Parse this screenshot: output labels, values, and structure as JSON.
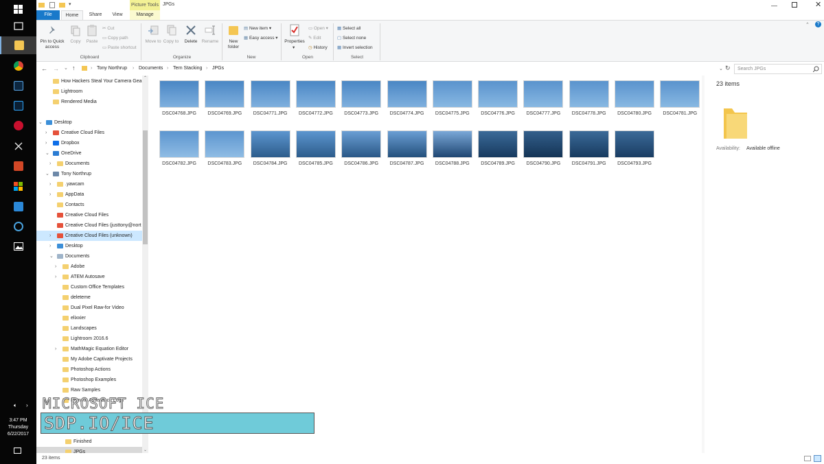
{
  "window": {
    "title": "JPGs",
    "contextual_tab": "Picture Tools"
  },
  "tabs": [
    "File",
    "Home",
    "Share",
    "View",
    "Manage"
  ],
  "ribbon": {
    "clipboard": {
      "pin": "Pin to Quick access",
      "copy": "Copy",
      "paste": "Paste",
      "cut": "Cut",
      "copy_path": "Copy path",
      "paste_shortcut": "Paste shortcut",
      "group": "Clipboard"
    },
    "organize": {
      "move_to": "Move to",
      "copy_to": "Copy to",
      "delete": "Delete",
      "rename": "Rename",
      "group": "Organize"
    },
    "new": {
      "new_folder": "New folder",
      "new_item": "New item",
      "easy_access": "Easy access",
      "group": "New"
    },
    "open": {
      "properties": "Properties",
      "open": "Open",
      "edit": "Edit",
      "history": "History",
      "group": "Open"
    },
    "select": {
      "select_all": "Select all",
      "select_none": "Select none",
      "invert": "Invert selection",
      "group": "Select"
    }
  },
  "address": {
    "crumbs": [
      "Tony Northrup",
      "Documents",
      "Tern Stacking",
      "JPGs"
    ],
    "search_placeholder": "Search JPGs"
  },
  "nav": [
    {
      "label": "How Hackers Steal Your Camera Gear",
      "level": 1,
      "icon": "folder",
      "chev": ""
    },
    {
      "label": "Lightroom",
      "level": 1,
      "icon": "folder",
      "chev": ""
    },
    {
      "label": "Rendered Media",
      "level": 1,
      "icon": "folder",
      "chev": ""
    },
    {
      "label": "",
      "level": 0,
      "icon": "",
      "chev": ""
    },
    {
      "label": "Desktop",
      "level": 0,
      "icon": "desktop",
      "chev": "v"
    },
    {
      "label": "Creative Cloud Files",
      "level": 1,
      "icon": "cc",
      "chev": ">"
    },
    {
      "label": "Dropbox",
      "level": 1,
      "icon": "dropbox",
      "chev": ">"
    },
    {
      "label": "OneDrive",
      "level": 1,
      "icon": "onedrive",
      "chev": "v"
    },
    {
      "label": "Documents",
      "level": 2,
      "icon": "folder",
      "chev": ">"
    },
    {
      "label": "Tony Northrup",
      "level": 1,
      "icon": "user",
      "chev": "v"
    },
    {
      "label": ".yawcam",
      "level": 2,
      "icon": "folder",
      "chev": ">"
    },
    {
      "label": "AppData",
      "level": 2,
      "icon": "folder",
      "chev": ">"
    },
    {
      "label": "Contacts",
      "level": 2,
      "icon": "folder",
      "chev": ""
    },
    {
      "label": "Creative Cloud Files",
      "level": 2,
      "icon": "cc",
      "chev": ""
    },
    {
      "label": "Creative Cloud Files (justtony@nort",
      "level": 2,
      "icon": "cc",
      "chev": ""
    },
    {
      "label": "Creative Cloud Files (unknown)",
      "level": 2,
      "icon": "cc",
      "chev": ">"
    },
    {
      "label": "Desktop",
      "level": 2,
      "icon": "desktop",
      "chev": ">"
    },
    {
      "label": "Documents",
      "level": 2,
      "icon": "docs",
      "chev": "v"
    },
    {
      "label": "Adobe",
      "level": 3,
      "icon": "folder",
      "chev": ">"
    },
    {
      "label": "ATEM Autosave",
      "level": 3,
      "icon": "folder",
      "chev": ">"
    },
    {
      "label": "Custom Office Templates",
      "level": 3,
      "icon": "folder",
      "chev": ""
    },
    {
      "label": "deleteme",
      "level": 3,
      "icon": "folder",
      "chev": ""
    },
    {
      "label": "Dual Pixel Raw-for Video",
      "level": 3,
      "icon": "folder",
      "chev": ""
    },
    {
      "label": "elixxier",
      "level": 3,
      "icon": "folder",
      "chev": ""
    },
    {
      "label": "Landscapes",
      "level": 3,
      "icon": "folder",
      "chev": ""
    },
    {
      "label": "Lightroom 2016.6",
      "level": 3,
      "icon": "folder",
      "chev": ""
    },
    {
      "label": "MathMagic Equation Editor",
      "level": 3,
      "icon": "folder",
      "chev": ">"
    },
    {
      "label": "My Adobe Captivate Projects",
      "level": 3,
      "icon": "folder",
      "chev": ""
    },
    {
      "label": "Photoshop Actions",
      "level": 3,
      "icon": "folder",
      "chev": ""
    },
    {
      "label": "Photoshop Examples",
      "level": 3,
      "icon": "folder",
      "chev": ""
    },
    {
      "label": "Raw Samples",
      "level": 3,
      "icon": "folder",
      "chev": ""
    },
    {
      "label": "Remote Assistance Logs",
      "level": 3,
      "icon": "folder",
      "chev": ""
    },
    {
      "label": "",
      "level": 3,
      "icon": "",
      "chev": ""
    },
    {
      "label": "",
      "level": 3,
      "icon": "",
      "chev": ""
    },
    {
      "label": "",
      "level": 3,
      "icon": "",
      "chev": ""
    },
    {
      "label": "Finished",
      "level": 4,
      "icon": "folder",
      "chev": ""
    },
    {
      "label": "JPGs",
      "level": 4,
      "icon": "folder",
      "chev": ""
    }
  ],
  "files": [
    {
      "name": "DSC04768.JPG",
      "top": "#4a86c4",
      "bottom": "#7fb0de"
    },
    {
      "name": "DSC04769.JPG",
      "top": "#4a86c4",
      "bottom": "#7fb0de"
    },
    {
      "name": "DSC04771.JPG",
      "top": "#4a86c4",
      "bottom": "#7fb0de"
    },
    {
      "name": "DSC04772.JPG",
      "top": "#4a86c4",
      "bottom": "#7fb0de"
    },
    {
      "name": "DSC04773.JPG",
      "top": "#4a86c4",
      "bottom": "#7fb0de"
    },
    {
      "name": "DSC04774.JPG",
      "top": "#4a86c4",
      "bottom": "#7fb0de"
    },
    {
      "name": "DSC04775.JPG",
      "top": "#5a93cd",
      "bottom": "#88b8e2"
    },
    {
      "name": "DSC04776.JPG",
      "top": "#5a93cd",
      "bottom": "#88b8e2"
    },
    {
      "name": "DSC04777.JPG",
      "top": "#5a93cd",
      "bottom": "#88b8e2"
    },
    {
      "name": "DSC04778.JPG",
      "top": "#5a93cd",
      "bottom": "#88b8e2"
    },
    {
      "name": "DSC04780.JPG",
      "top": "#5a93cd",
      "bottom": "#88b8e2"
    },
    {
      "name": "DSC04781.JPG",
      "top": "#5a93cd",
      "bottom": "#88b8e2"
    },
    {
      "name": "DSC04782.JPG",
      "top": "#5c95cf",
      "bottom": "#8fbce4"
    },
    {
      "name": "DSC04783.JPG",
      "top": "#5c95cf",
      "bottom": "#8fbce4"
    },
    {
      "name": "DSC04784.JPG",
      "top": "#5c95cf",
      "bottom": "#2d5d8c"
    },
    {
      "name": "DSC04785.JPG",
      "top": "#5c95cf",
      "bottom": "#2d5d8c"
    },
    {
      "name": "DSC04786.JPG",
      "top": "#6a9ed4",
      "bottom": "#2a5887"
    },
    {
      "name": "DSC04787.JPG",
      "top": "#6a9ed4",
      "bottom": "#24507c"
    },
    {
      "name": "DSC04788.JPG",
      "top": "#7aa8d8",
      "bottom": "#1f4672"
    },
    {
      "name": "DSC04789.JPG",
      "top": "#3b6a98",
      "bottom": "#173a5f"
    },
    {
      "name": "DSC04790.JPG",
      "top": "#335f8b",
      "bottom": "#143456"
    },
    {
      "name": "DSC04791.JPG",
      "top": "#3b6a98",
      "bottom": "#173a5f"
    },
    {
      "name": "DSC04793.JPG",
      "top": "#3b6a98",
      "bottom": "#1a3d63"
    }
  ],
  "details": {
    "item_count": "23 items",
    "availability_label": "Availability:",
    "availability_value": "Available offline"
  },
  "status": {
    "count": "23 items"
  },
  "clock": {
    "time": "3:47 PM",
    "day": "Thursday",
    "date": "6/22/2017"
  },
  "overlay": {
    "title": "MICROSOFT ICE",
    "url": "SDP.IO/ICE"
  },
  "colors": {
    "accent": "#1979ca",
    "tab_highlight": "#f3f195",
    "selection": "#cce8ff",
    "banner": "#6fcbd9"
  }
}
